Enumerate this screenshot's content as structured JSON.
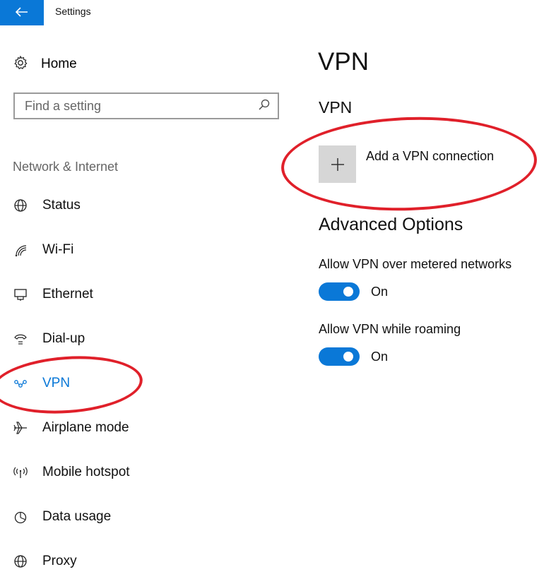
{
  "window": {
    "title": "Settings",
    "back_icon": "arrow-left-icon"
  },
  "home": {
    "label": "Home",
    "icon": "gear-icon"
  },
  "search": {
    "placeholder": "Find a setting",
    "icon": "search-icon"
  },
  "sidebar": {
    "section_label": "Network & Internet",
    "items": [
      {
        "label": "Status",
        "icon": "globe-status-icon"
      },
      {
        "label": "Wi-Fi",
        "icon": "wifi-icon"
      },
      {
        "label": "Ethernet",
        "icon": "ethernet-icon"
      },
      {
        "label": "Dial-up",
        "icon": "phone-dialup-icon"
      },
      {
        "label": "VPN",
        "icon": "vpn-icon",
        "selected": true
      },
      {
        "label": "Airplane mode",
        "icon": "airplane-icon"
      },
      {
        "label": "Mobile hotspot",
        "icon": "hotspot-icon"
      },
      {
        "label": "Data usage",
        "icon": "pie-chart-icon"
      },
      {
        "label": "Proxy",
        "icon": "globe-icon"
      }
    ]
  },
  "main": {
    "page_title": "VPN",
    "vpn_heading": "VPN",
    "add_vpn_label": "Add a VPN connection",
    "advanced_heading": "Advanced Options",
    "settings": [
      {
        "label": "Allow VPN over metered networks",
        "state": "On"
      },
      {
        "label": "Allow VPN while roaming",
        "state": "On"
      }
    ]
  },
  "colors": {
    "accent": "#0a78d7",
    "annotation": "#e0202a",
    "tile": "#d6d6d6"
  }
}
